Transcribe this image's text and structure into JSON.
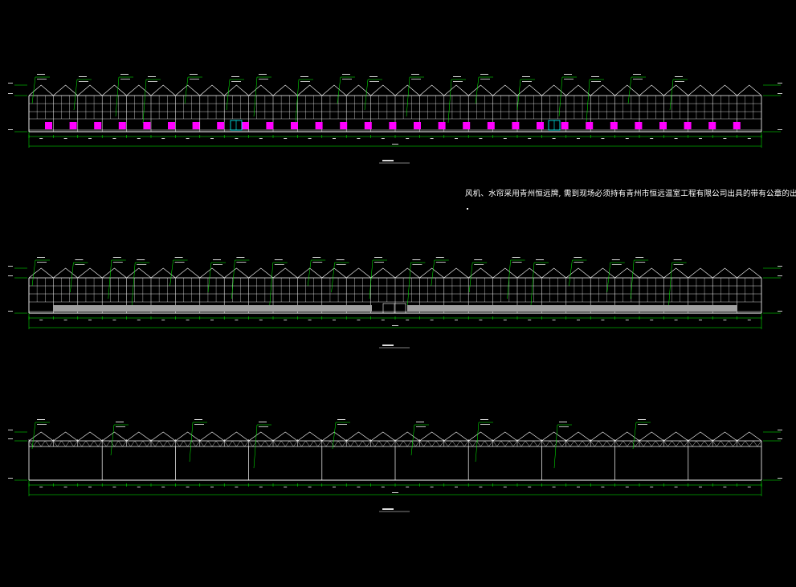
{
  "note": {
    "text": "风机、水帘采用青州恒远牌, 需到现场必须持有青州市恒远温室工程有限公司出具的带有公章的出厂证明"
  },
  "colors": {
    "background": "#000000",
    "frame": "#ffffff",
    "dimension": "#00ff00",
    "fan_unit": "#ff00ff",
    "door": "#00ffff",
    "wall_band": "#a0a0a0",
    "title_underline": "#ffffff"
  },
  "elevations": [
    {
      "id": "front-elevation",
      "bays": 30,
      "fan_units": 29,
      "doors": 2,
      "leader_callouts": 18
    },
    {
      "id": "rear-elevation",
      "bays": 30,
      "wall_band": true,
      "doors": 1,
      "leader_callouts": 20
    },
    {
      "id": "side-elevation",
      "bays": 30,
      "posts": 10,
      "leader_callouts": 9
    }
  ]
}
